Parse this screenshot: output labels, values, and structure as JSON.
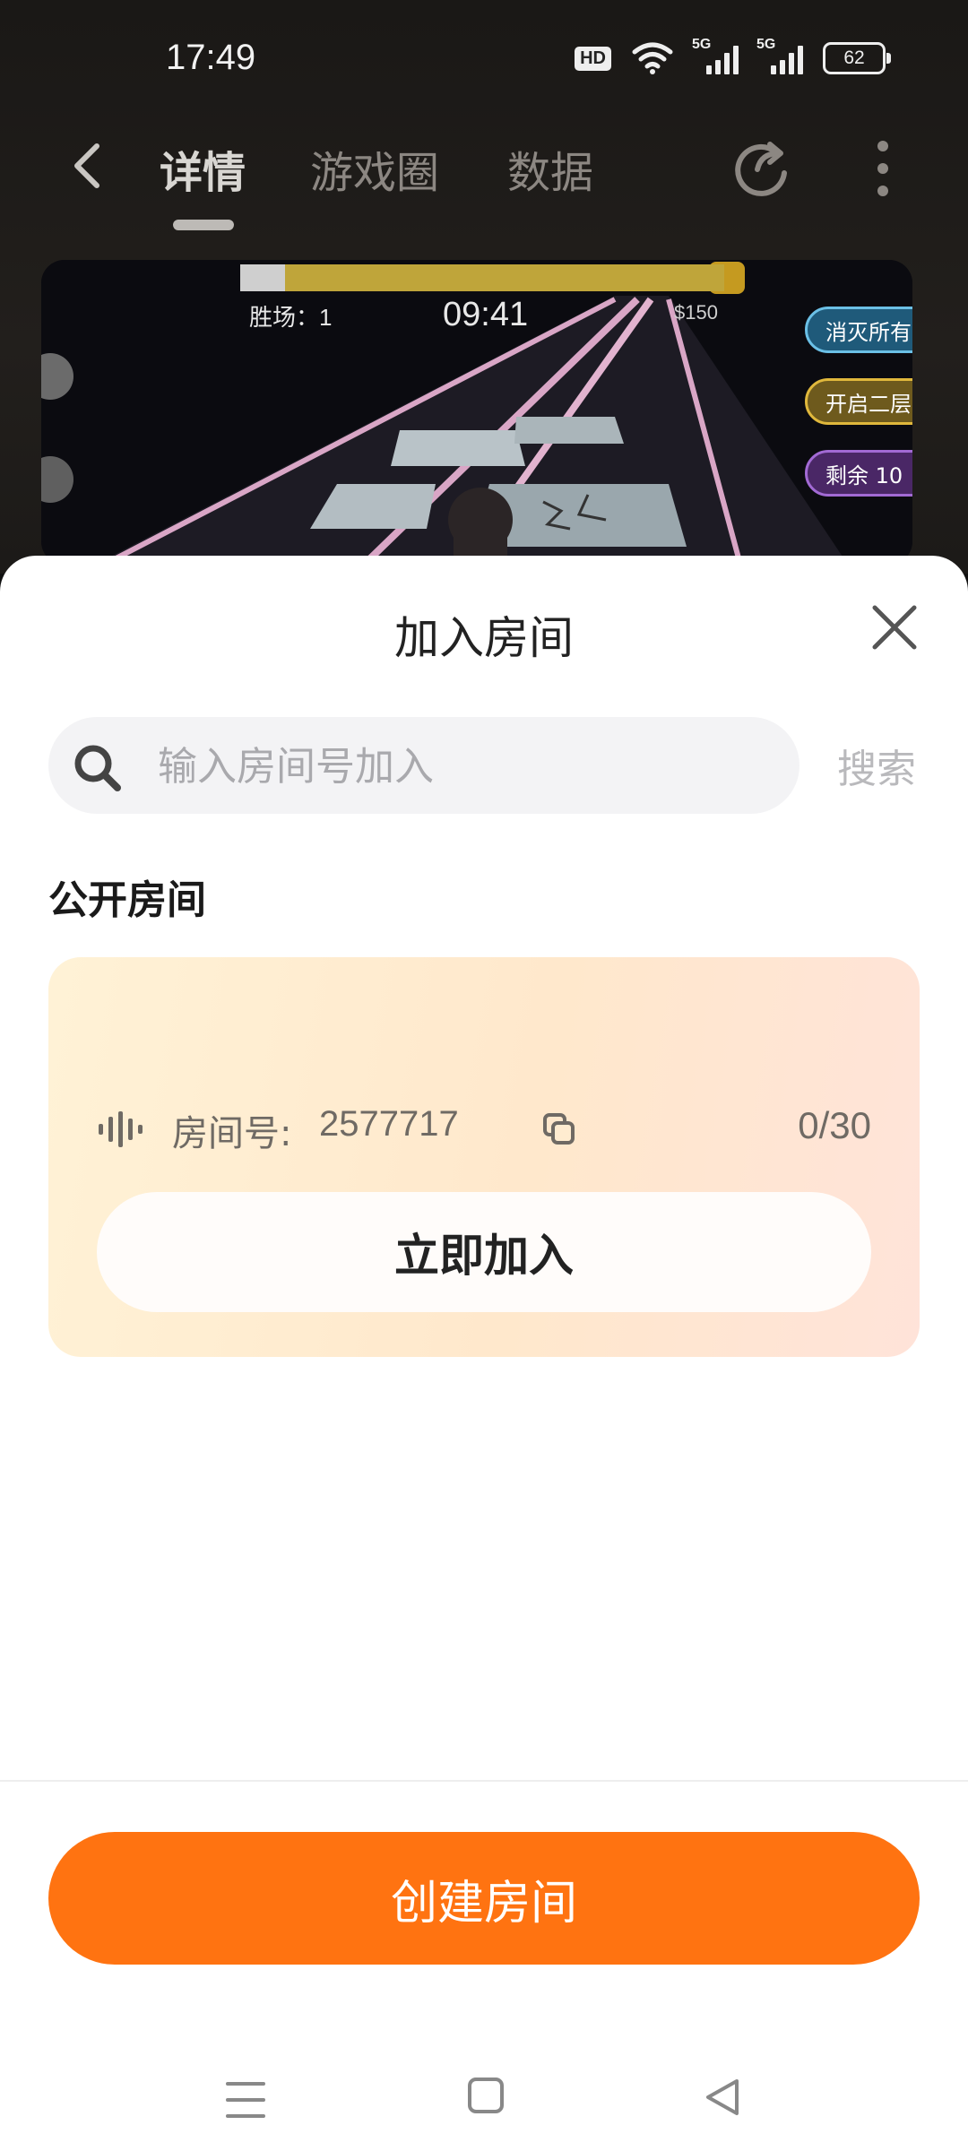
{
  "status_bar": {
    "time": "17:49",
    "hd_label": "HD",
    "signal_1_label": "5G",
    "signal_2_label": "5G",
    "battery": "62"
  },
  "nav": {
    "tabs": [
      {
        "label": "详情",
        "active": true
      },
      {
        "label": "游戏圈",
        "active": false
      },
      {
        "label": "数据",
        "active": false
      }
    ],
    "icons": [
      "back-icon",
      "share-icon",
      "more-icon"
    ]
  },
  "video": {
    "wins_label": "胜场：1",
    "timer": "09:41",
    "money": "$150",
    "pills": [
      "消灭所有",
      "开启二层",
      "剩余 10"
    ]
  },
  "sheet": {
    "title": "加入房间",
    "search_placeholder": "输入房间号加入",
    "search_value": "",
    "search_button": "搜索",
    "section_title": "公开房间",
    "room": {
      "label": "房间号:",
      "number": "2577717",
      "count": "0/30",
      "join_button": "立即加入"
    },
    "create_button": "创建房间"
  },
  "colors": {
    "accent": "#ff7311",
    "card_gradient_start": "#fff2d6",
    "card_gradient_end": "#ffe3d9"
  }
}
